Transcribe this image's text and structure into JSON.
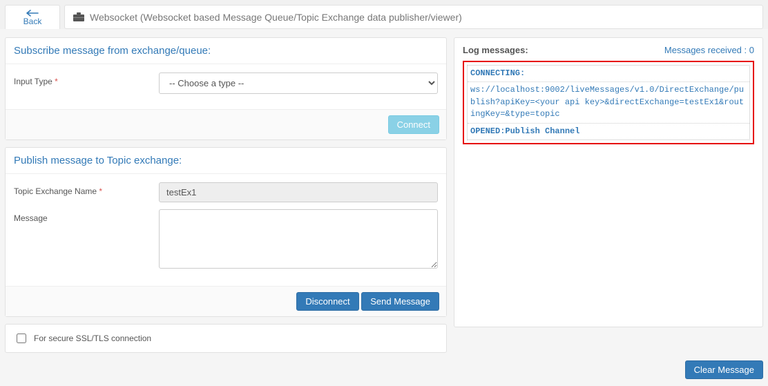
{
  "header": {
    "back": "Back",
    "title": "Websocket (Websocket based Message Queue/Topic Exchange data publisher/viewer)"
  },
  "subscribe": {
    "title": "Subscribe message from exchange/queue:",
    "input_type_label": "Input Type",
    "select_placeholder": "-- Choose a type --",
    "connect": "Connect"
  },
  "publish": {
    "title": "Publish message to Topic exchange:",
    "exchange_label": "Topic Exchange Name",
    "exchange_value": "testEx1",
    "message_label": "Message",
    "message_value": "",
    "disconnect": "Disconnect",
    "send": "Send Message"
  },
  "ssl": {
    "label": "For secure SSL/TLS connection"
  },
  "log": {
    "title": "Log messages:",
    "received_label": "Messages received :",
    "received_count": "0",
    "lines": {
      "l0": "CONNECTING:",
      "l1": "ws://localhost:9002/liveMessages/v1.0/DirectExchange/publish?apiKey=<your api key>&directExchange=testEx1&routingKey=&type=topic",
      "l2": "OPENED:Publish Channel"
    }
  },
  "clear": "Clear Message"
}
